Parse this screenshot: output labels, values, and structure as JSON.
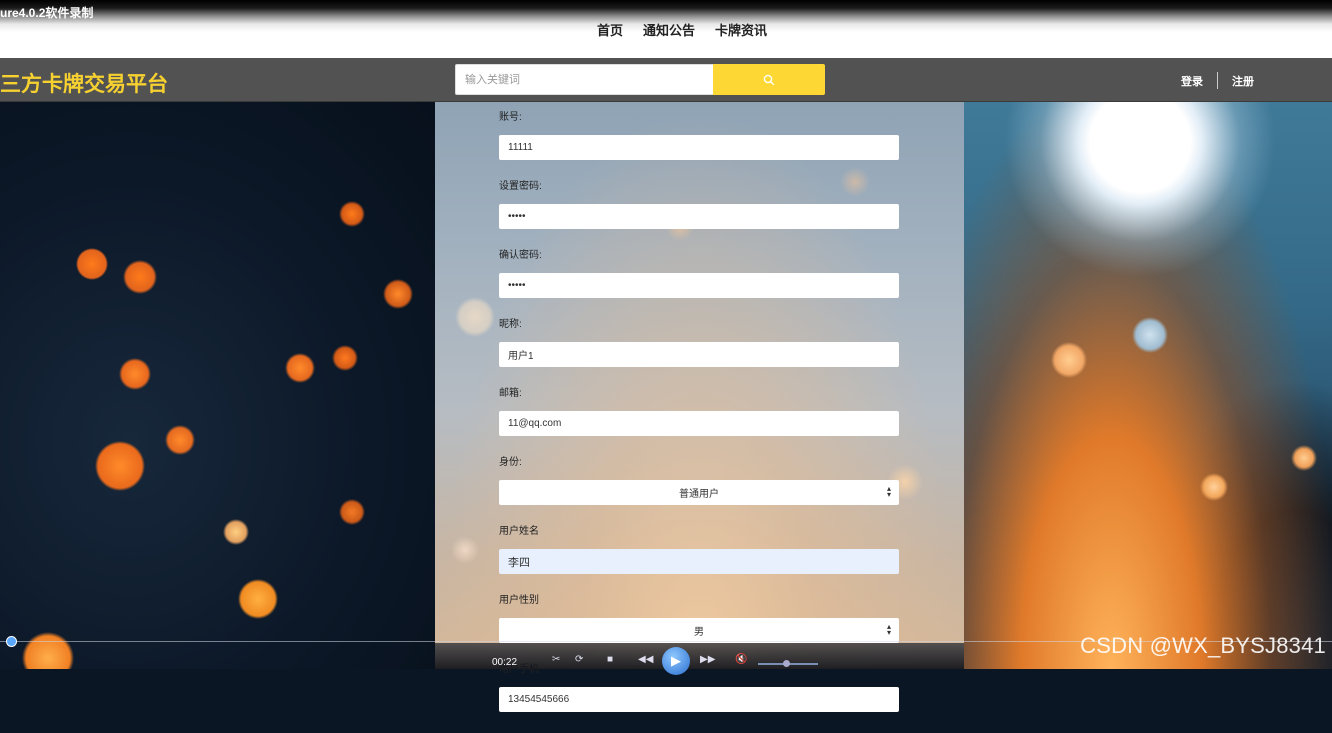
{
  "recorder": {
    "title": "ure4.0.2软件录制"
  },
  "topnav": {
    "items": [
      "首页",
      "通知公告",
      "卡牌资讯"
    ]
  },
  "header": {
    "brand": "三方卡牌交易平台",
    "search": {
      "placeholder": "输入关键词",
      "value": ""
    },
    "auth": {
      "login": "登录",
      "register": "注册"
    }
  },
  "form": {
    "account": {
      "label": "账号:",
      "value": "11111"
    },
    "password": {
      "label": "设置密码:",
      "value": "11111"
    },
    "confirm": {
      "label": "确认密码:",
      "value": "11111"
    },
    "nickname": {
      "label": "昵称:",
      "value": "用户1"
    },
    "email": {
      "label": "邮箱:",
      "value": "11@qq.com"
    },
    "identity": {
      "label": "身份:",
      "value": "普通用户"
    },
    "realname": {
      "label": "用户姓名",
      "value": "李四"
    },
    "gender": {
      "label": "用户性别",
      "value": "男"
    },
    "phone": {
      "label": "用户手机",
      "value": "13454545666"
    }
  },
  "player": {
    "time": "00:22",
    "progress": 0.004
  },
  "watermark": "CSDN @WX_BYSJ8341",
  "colors": {
    "brand": "#f6d130",
    "search_button": "#fdd835",
    "header_bg": "#525252"
  }
}
